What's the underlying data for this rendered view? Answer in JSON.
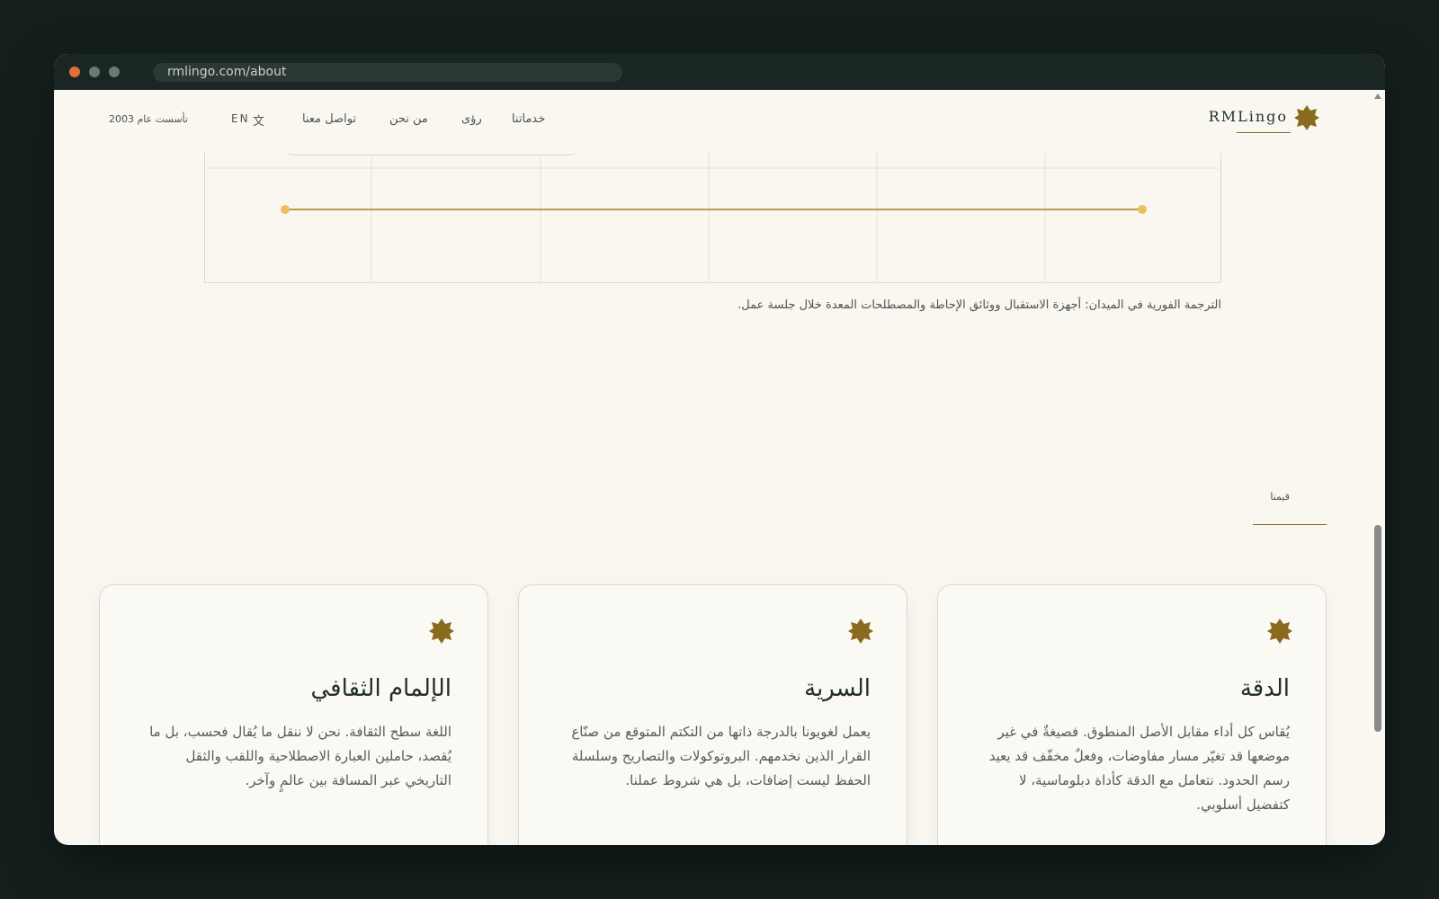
{
  "browser": {
    "url": "rmlingo.com/about"
  },
  "header": {
    "logo": "RMLingo",
    "nav": [
      "خدماتنا",
      "رؤى",
      "من نحن",
      "تواصل معنا"
    ],
    "lang": "EN",
    "founded": "تأسست عام 2003"
  },
  "figure": {
    "caption": "الترجمة الفورية في الميدان: أجهزة الاستقبال ووثائق الإحاطة والمصطلحات المعدة خلال جلسة عمل."
  },
  "values": {
    "label": "قيمنا",
    "cards": [
      {
        "title": "الدقة",
        "body": "يُقاس كل أداء مقابل الأصل المنطوق. فصيغةٌ في غير موضعها قد تغيّر مسار مفاوضات، وفعلٌ مخفّف قد يعيد رسم الحدود. نتعامل مع الدقة كأداة دبلوماسية، لا كتفضيل أسلوبي."
      },
      {
        "title": "السرية",
        "body": "يعمل لغويونا بالدرجة ذاتها من التكتم المتوقع من صنّاع القرار الذين نخدمهم. البروتوكولات والتصاريح وسلسلة الحفظ ليست إضافات، بل هي شروط عملنا."
      },
      {
        "title": "الإلمام الثقافي",
        "body": "اللغة سطح الثقافة. نحن لا ننقل ما يُقال فحسب، بل ما يُقصد، حاملين العبارة الاصطلاحية واللقب والثقل التاريخي عبر المسافة بين عالمٍ وآخر."
      }
    ]
  },
  "colors": {
    "accent": "#8a6a1e",
    "line": "#b99a52",
    "point": "#e9c25a"
  }
}
